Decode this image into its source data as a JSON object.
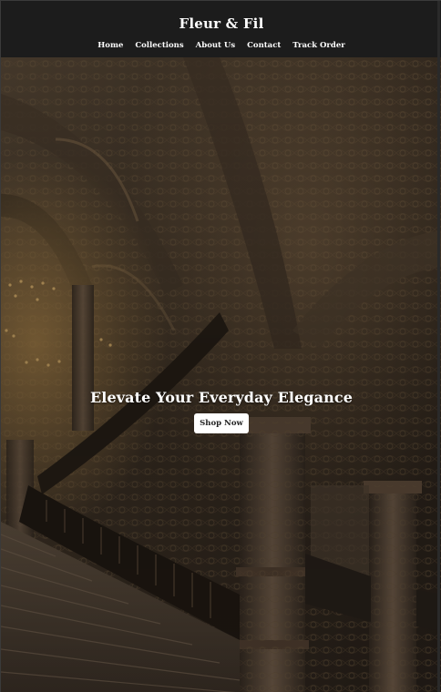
{
  "header": {
    "brand": "Fleur & Fil",
    "nav": [
      "Home",
      "Collections",
      "About Us",
      "Contact",
      "Track Order"
    ]
  },
  "hero": {
    "title": "Elevate Your Everyday Elegance",
    "cta_label": "Shop Now",
    "image_description_icon": "opera-staircase-photo"
  },
  "colors": {
    "header_bg": "#1c1c1c",
    "text": "#ffffff",
    "button_bg": "#ffffff",
    "button_text": "#222222"
  }
}
